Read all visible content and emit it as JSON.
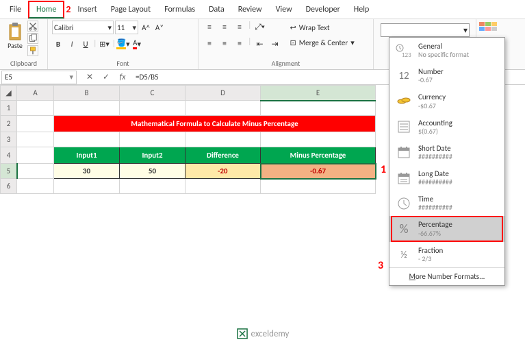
{
  "tabs": [
    "File",
    "Home",
    "Insert",
    "Page Layout",
    "Formulas",
    "Data",
    "Review",
    "View",
    "Developer",
    "Help"
  ],
  "active_tab": "Home",
  "callouts": {
    "tab": "2",
    "cell": "1",
    "dropdown": "3"
  },
  "ribbon": {
    "clipboard": {
      "label": "Clipboard",
      "paste": "Paste"
    },
    "font": {
      "label": "Font",
      "name": "Calibri",
      "size": "11",
      "bold": "B",
      "italic": "I",
      "underline": "U"
    },
    "alignment": {
      "label": "Alignment",
      "wrap": "Wrap Text",
      "merge": "Merge & Center"
    }
  },
  "namebox": "E5",
  "formula": "=D5/B5",
  "sheet": {
    "cols": [
      "A",
      "B",
      "C",
      "D",
      "E"
    ],
    "rows": [
      "1",
      "2",
      "3",
      "4",
      "5",
      "6"
    ],
    "title": "Mathematical Formula to Calculate Minus Percentage",
    "headers": [
      "Input1",
      "Input2",
      "Difference",
      "Minus Percentage"
    ],
    "data": {
      "input1": "30",
      "input2": "50",
      "diff": "-20",
      "minus": "-0.67"
    }
  },
  "dropdown": {
    "items": [
      {
        "name": "General",
        "sample": "No specific format",
        "icon": "123"
      },
      {
        "name": "Number",
        "sample": "-0.67",
        "icon": "12"
      },
      {
        "name": "Currency",
        "sample": "-$0.67",
        "icon": "coins"
      },
      {
        "name": "Accounting",
        "sample": "$(0.67)",
        "icon": "ledger"
      },
      {
        "name": "Short Date",
        "sample": "##########",
        "icon": "cal"
      },
      {
        "name": "Long Date",
        "sample": "##########",
        "icon": "cal"
      },
      {
        "name": "Time",
        "sample": "##########",
        "icon": "clock"
      },
      {
        "name": "Percentage",
        "sample": "-66.67%",
        "icon": "%"
      },
      {
        "name": "Fraction",
        "sample": "- 2/3",
        "icon": "1/2"
      }
    ],
    "more": "More Number Formats..."
  },
  "logo": "exceldemy",
  "chart_data": {
    "type": "table",
    "title": "Mathematical Formula to Calculate Minus Percentage",
    "columns": [
      "Input1",
      "Input2",
      "Difference",
      "Minus Percentage"
    ],
    "rows": [
      [
        30,
        50,
        -20,
        -0.67
      ]
    ]
  }
}
